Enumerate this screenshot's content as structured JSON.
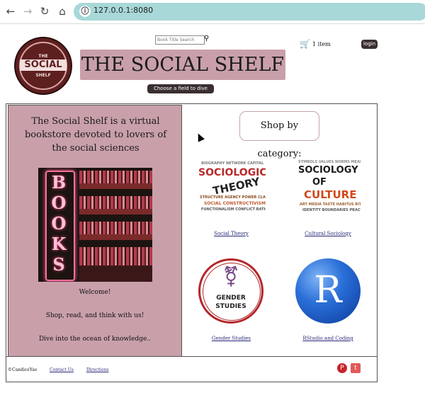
{
  "browser": {
    "url": "127.0.0.1:8080",
    "back_icon": "←",
    "forward_icon": "→",
    "reload_icon": "↻",
    "home_icon": "⌂",
    "info_icon": "ⓘ"
  },
  "header": {
    "logo": {
      "line1": "THE",
      "line2": "SOCIAL",
      "line3": "SHELF"
    },
    "search": {
      "placeholder": "Book Title Search"
    },
    "title": "THE SOCIAL SHELF",
    "dive_button": "Choose a field to dive into!",
    "cart_count": "1 item",
    "login_label": "login"
  },
  "left_panel": {
    "tagline": "The Social Shelf is a virtual bookstore devoted to lovers of the social sciences",
    "photo_letters": [
      "B",
      "O",
      "O",
      "K",
      "S"
    ],
    "welcome": "Welcome!",
    "shop_text": "Shop, read, and think with us!",
    "dive_text": "Dive into the ocean of knowledge.."
  },
  "categories": {
    "title": "Shop by category:",
    "items": [
      {
        "label": "Social Theory",
        "image_text": [
          "SOCIOLOGICAL",
          "THEORY"
        ]
      },
      {
        "label": "Cultural Sociology",
        "image_text": [
          "SOCIOLOGY",
          "OF",
          "CULTURE"
        ]
      },
      {
        "label": "Gender Studies",
        "image_text": [
          "GENDER",
          "STUDIES"
        ]
      },
      {
        "label": "RStudio and Coding",
        "image_text": [
          "R"
        ]
      }
    ]
  },
  "footer": {
    "copyright": "©CandiceYao",
    "contact": "Contact Us",
    "directions": "Directions"
  },
  "colors": {
    "panel_pink": "#c9a0aa",
    "dark_button": "#3a2f30",
    "url_bar": "#a8d8d8",
    "pinterest": "#c8232c",
    "twitter": "#e05a5a"
  }
}
